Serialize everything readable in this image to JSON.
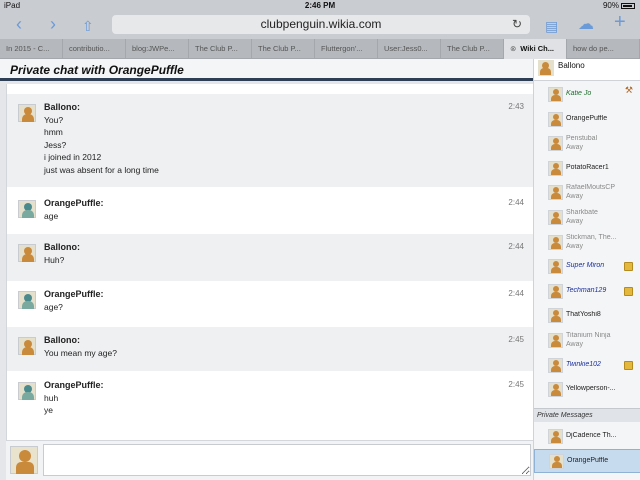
{
  "status": {
    "device": "iPad",
    "time": "2:46 PM",
    "battery": "90%"
  },
  "browser": {
    "url": "clubpenguin.wikia.com",
    "tabs": [
      "In 2015 - C...",
      "contributio...",
      "blog:JWPe...",
      "The Club P...",
      "The Club P...",
      "Fluttergon'...",
      "User:Jess0...",
      "The Club P...",
      "Wiki Ch...",
      "how do pe..."
    ],
    "active_tab": 8
  },
  "chat": {
    "header": "Private chat with OrangePuffle",
    "messages": [
      {
        "name": "Ballono:",
        "time": "2:43",
        "lines": [
          "You?",
          "hmm",
          "Jess?",
          "i joined in 2012",
          "just was absent for a long time"
        ]
      },
      {
        "name": "OrangePuffle:",
        "time": "2:44",
        "lines": [
          "age"
        ]
      },
      {
        "name": "Ballono:",
        "time": "2:44",
        "lines": [
          "Huh?"
        ]
      },
      {
        "name": "OrangePuffle:",
        "time": "2:44",
        "lines": [
          "age?"
        ]
      },
      {
        "name": "Ballono:",
        "time": "2:45",
        "lines": [
          "You mean my age?"
        ]
      },
      {
        "name": "OrangePuffle:",
        "time": "2:45",
        "lines": [
          "huh",
          "ye"
        ]
      }
    ],
    "input_value": ""
  },
  "sidebar": {
    "me": "Ballono",
    "users": [
      {
        "name": "Katie Jo",
        "status": "",
        "type": "staff",
        "badge": "hammer"
      },
      {
        "name": "OrangePuffle",
        "status": "",
        "type": "",
        "badge": ""
      },
      {
        "name": "Penstubal",
        "status": "Away",
        "type": "away",
        "badge": ""
      },
      {
        "name": "PotatoRacer1",
        "status": "",
        "type": "",
        "badge": ""
      },
      {
        "name": "RafaelMoutsCP",
        "status": "Away",
        "type": "away",
        "badge": ""
      },
      {
        "name": "Sharkbate",
        "status": "Away",
        "type": "away",
        "badge": ""
      },
      {
        "name": "Stickman, The...",
        "status": "Away",
        "type": "away",
        "badge": ""
      },
      {
        "name": "Super Miron",
        "status": "",
        "type": "mod",
        "badge": "star"
      },
      {
        "name": "Techman129",
        "status": "",
        "type": "mod",
        "badge": "star"
      },
      {
        "name": "ThatYoshi8",
        "status": "",
        "type": "",
        "badge": ""
      },
      {
        "name": "Titanium Ninja",
        "status": "Away",
        "type": "away",
        "badge": ""
      },
      {
        "name": "Twinkie102",
        "status": "",
        "type": "mod",
        "badge": "star"
      },
      {
        "name": "Yellowperson-...",
        "status": "",
        "type": "",
        "badge": ""
      }
    ],
    "pm_header": "Private Messages",
    "pm_users": [
      "DjCadence Th...",
      "OrangePuffle"
    ],
    "pm_selected": 1
  }
}
